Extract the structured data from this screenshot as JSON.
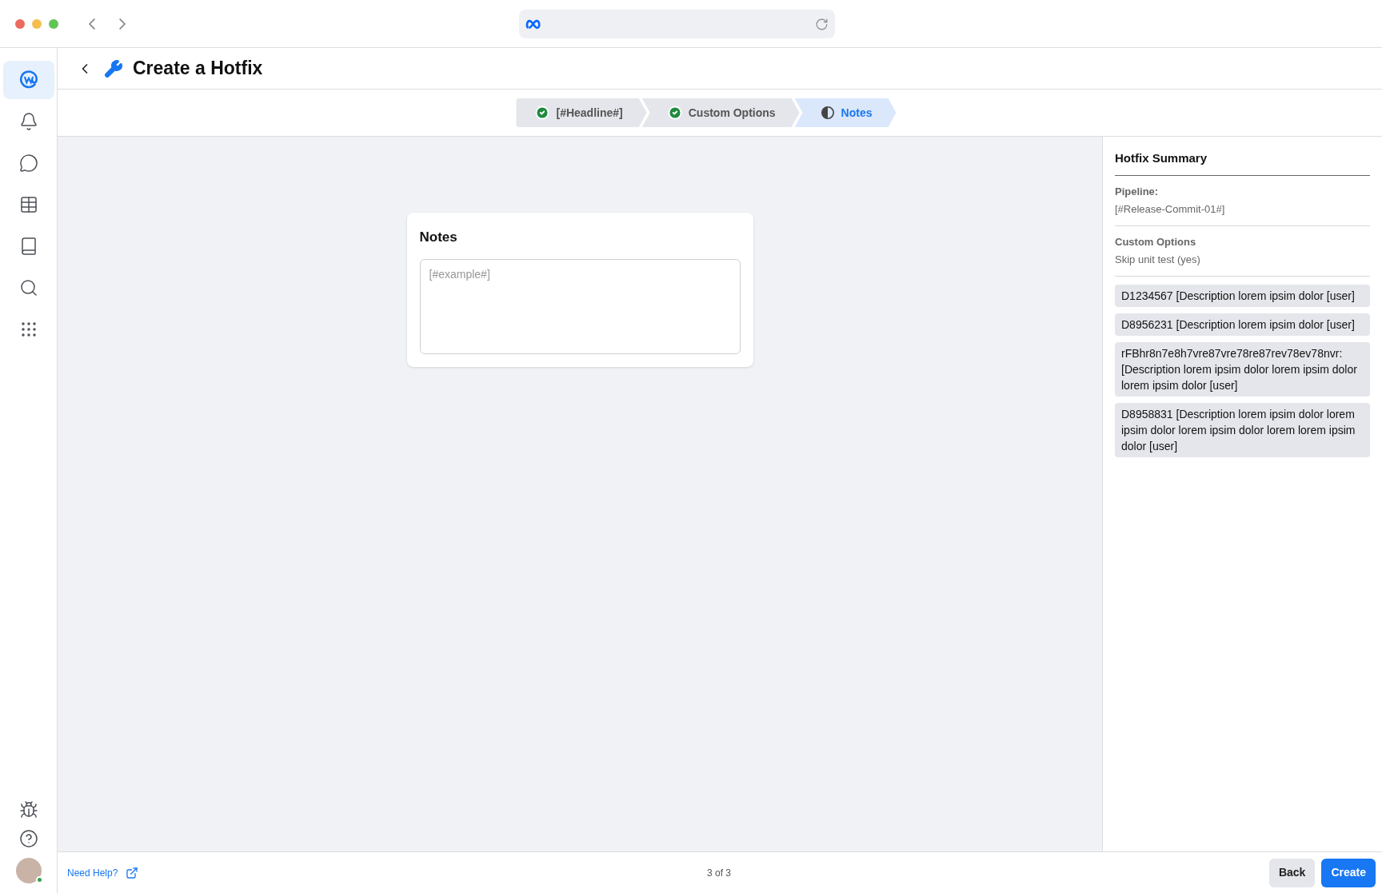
{
  "sidebar": {
    "items": [
      {
        "selected": true
      },
      {
        "selected": false
      },
      {
        "selected": false
      },
      {
        "selected": false
      },
      {
        "selected": false
      },
      {
        "selected": false
      },
      {
        "selected": false
      }
    ],
    "avatar": {
      "online": true
    }
  },
  "header": {
    "title": "Create a Hotfix"
  },
  "steps": [
    {
      "label": "[#Headline#]",
      "done": true,
      "selected": false
    },
    {
      "label": "Custom Options",
      "done": true,
      "selected": false
    },
    {
      "label": "Notes",
      "done": false,
      "selected": true
    }
  ],
  "notes_card": {
    "title": "Notes",
    "placeholder": "[#example#]"
  },
  "summary": {
    "title": "Hotfix Summary",
    "sections": [
      {
        "label": "Pipeline:",
        "value": "[#Release-Commit-01#]"
      },
      {
        "label": "Custom Options",
        "value": "Skip unit test (yes)"
      }
    ],
    "diffs": [
      "D1234567 [Description lorem ipsim dolor [user]",
      "D8956231 [Description lorem ipsim dolor [user]",
      "rFBhr8n7e8h7vre87vre78re87rev78ev78nvr: [Description lorem ipsim dolor lorem ipsim dolor lorem ipsim dolor [user]",
      "D8958831 [Description lorem ipsim dolor lorem ipsim dolor lorem ipsim dolor lorem lorem ipsim dolor [user]"
    ]
  },
  "footer": {
    "help_link": "Need Help?",
    "page": "3 of 3",
    "buttons": [
      {
        "label": "Back",
        "kind": "secondary"
      },
      {
        "label": "Create",
        "kind": "primary"
      }
    ]
  }
}
